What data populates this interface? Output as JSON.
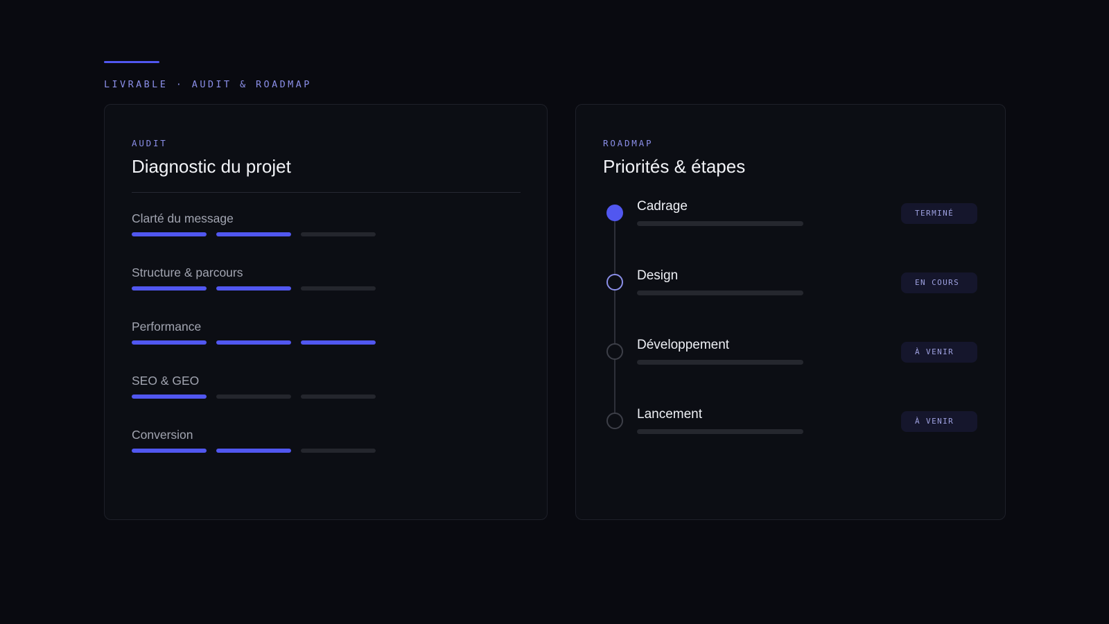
{
  "header": {
    "label": "LIVRABLE · AUDIT & ROADMAP"
  },
  "colors": {
    "accent": "#5157f0",
    "accent_light": "#8b8fe8",
    "background": "#090a10",
    "card": "#0c0e14",
    "track": "#24262d"
  },
  "audit": {
    "kicker": "AUDIT",
    "title": "Diagnostic du projet",
    "criteria": [
      {
        "label": "Clarté du message",
        "score": 2,
        "max": 3
      },
      {
        "label": "Structure & parcours",
        "score": 2,
        "max": 3
      },
      {
        "label": "Performance",
        "score": 3,
        "max": 3
      },
      {
        "label": "SEO & GEO",
        "score": 1,
        "max": 3
      },
      {
        "label": "Conversion",
        "score": 2,
        "max": 3
      }
    ]
  },
  "roadmap": {
    "kicker": "ROADMAP",
    "title": "Priorités & étapes",
    "steps": [
      {
        "name": "Cadrage",
        "status": "TERMINÉ",
        "state": "done",
        "marker_icon": "filled-circle-icon"
      },
      {
        "name": "Design",
        "status": "EN COURS",
        "state": "current",
        "marker_icon": "ring-circle-icon"
      },
      {
        "name": "Développement",
        "status": "À VENIR",
        "state": "upcoming",
        "marker_icon": "empty-circle-icon"
      },
      {
        "name": "Lancement",
        "status": "À VENIR",
        "state": "upcoming",
        "marker_icon": "empty-circle-icon"
      }
    ]
  }
}
